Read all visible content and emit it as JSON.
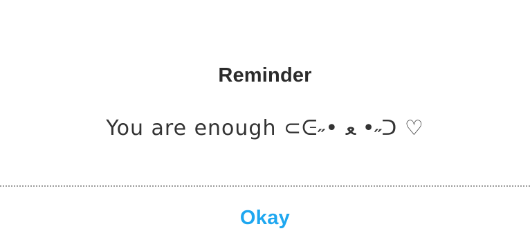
{
  "dialog": {
    "title": "Reminder",
    "message": "You are enough ⊂ᕮ˶• ﻌ •˶ᑐ ♡",
    "ok_label": "Okay"
  },
  "colors": {
    "accent": "#1ea7f0",
    "title_text": "#2b2b2b",
    "message_text": "#333333",
    "divider": "#9a9a9a",
    "background": "#ffffff"
  }
}
